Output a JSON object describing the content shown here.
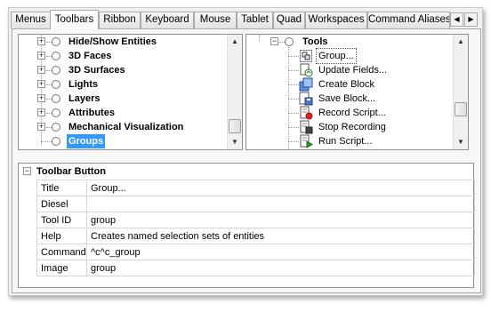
{
  "tabs": [
    {
      "label": "Menus",
      "active": false
    },
    {
      "label": "Toolbars",
      "active": true
    },
    {
      "label": "Ribbon",
      "active": false
    },
    {
      "label": "Keyboard",
      "active": false
    },
    {
      "label": "Mouse",
      "active": false
    },
    {
      "label": "Tablet",
      "active": false
    },
    {
      "label": "Quad",
      "active": false
    },
    {
      "label": "Workspaces",
      "active": false
    },
    {
      "label": "Command Aliases",
      "active": false
    }
  ],
  "tab_scroll": {
    "left_icon": "arrow-left-icon",
    "right_icon": "arrow-right-icon",
    "left_glyph": "◀",
    "right_glyph": "▶"
  },
  "left_tree": {
    "items": [
      {
        "label": "Hide/Show Entities",
        "bold": true
      },
      {
        "label": "3D Faces",
        "bold": true
      },
      {
        "label": "3D Surfaces",
        "bold": true
      },
      {
        "label": "Lights",
        "bold": true
      },
      {
        "label": "Layers",
        "bold": true
      },
      {
        "label": "Attributes",
        "bold": true
      },
      {
        "label": "Mechanical Visualization",
        "bold": true
      },
      {
        "label": "Groups",
        "bold": true,
        "selected": true
      }
    ]
  },
  "right_tree": {
    "root": {
      "label": "Tools"
    },
    "items": [
      {
        "label": "Group...",
        "icon": "group-icon",
        "focused": true
      },
      {
        "label": "Update Fields...",
        "icon": "update-fields-icon"
      },
      {
        "label": "Create Block",
        "icon": "create-block-icon"
      },
      {
        "label": "Save Block...",
        "icon": "save-block-icon"
      },
      {
        "label": "Record Script...",
        "icon": "record-script-icon"
      },
      {
        "label": "Stop Recording",
        "icon": "stop-recording-icon"
      },
      {
        "label": "Run Script...",
        "icon": "run-script-icon"
      }
    ]
  },
  "properties": {
    "title": "Toolbar Button",
    "rows": [
      {
        "key": "Title",
        "value": "Group..."
      },
      {
        "key": "Diesel",
        "value": ""
      },
      {
        "key": "Tool ID",
        "value": "group"
      },
      {
        "key": "Help",
        "value": "Creates named selection sets of entities"
      },
      {
        "key": "Command",
        "value": "^c^c_group"
      },
      {
        "key": "Image",
        "value": "group"
      }
    ]
  },
  "colors": {
    "selection": "#3399ff",
    "frame": "#f0f0f0"
  }
}
